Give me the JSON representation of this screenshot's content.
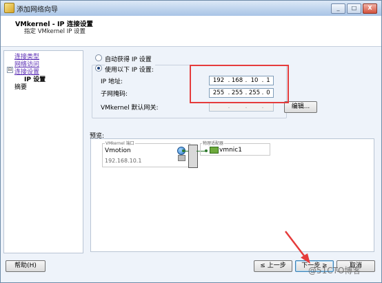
{
  "window": {
    "title": "添加网络向导",
    "controls": [
      "_",
      "□",
      "X"
    ]
  },
  "header": {
    "title": "VMkernel - IP 连接设置",
    "subtitle": "指定 VMkernel IP 设置"
  },
  "nav": {
    "items": [
      {
        "label": "连接类型",
        "state": "link"
      },
      {
        "label": "网络访问",
        "state": "link"
      },
      {
        "label": "连接设置",
        "state": "link",
        "expander": "⊟"
      },
      {
        "label": "IP 设置",
        "state": "current"
      },
      {
        "label": "摘要",
        "state": "pending"
      }
    ]
  },
  "ip": {
    "option_auto": "自动获得 IP 设置",
    "option_manual": "使用以下 IP 设置:",
    "selected": "manual",
    "ip_label": "IP 地址:",
    "ip_octets": [
      "192",
      "168",
      "10",
      "1"
    ],
    "mask_label": "子网掩码:",
    "mask_octets": [
      "255",
      "255",
      "255",
      "0"
    ],
    "gateway_label": "VMkernel 默认网关:",
    "gateway_octets": [
      "",
      "",
      "",
      ""
    ],
    "edit_button": "编辑..."
  },
  "preview": {
    "label": "预览:",
    "vmk_caption": "VMkernel 端口",
    "vmk_name": "Vmotion",
    "vmk_ip": "192.168.10.1",
    "nic_caption": "物理适配器",
    "nic_name": "vmnic1"
  },
  "buttons": {
    "help": "帮助(H)",
    "back": "≤ 上一步",
    "next": "下一步 ≥",
    "cancel": "取消"
  },
  "watermark": "@51CTO博客",
  "colors": {
    "highlight_box": "#e53b3b",
    "annotation_arrow": "#e53b3b",
    "nav_link": "#5a2db3"
  }
}
